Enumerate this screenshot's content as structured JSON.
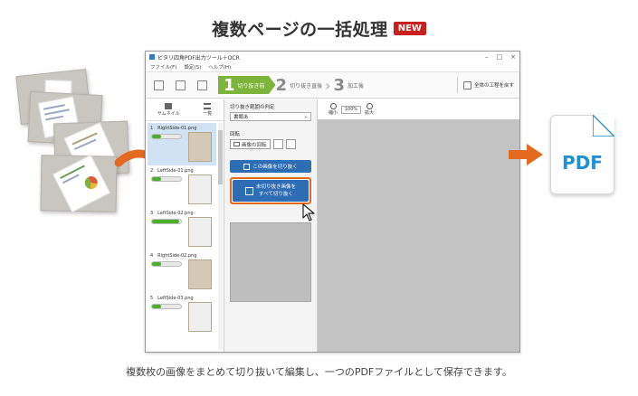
{
  "heading": {
    "title": "複数ページの一括処理",
    "badge": "NEW"
  },
  "window": {
    "title": "ピタリ四角PDF出力ツール＋OCR",
    "menu": [
      "ファイル(F)",
      "設定(S)",
      "ヘルプ(H)"
    ],
    "steps": [
      {
        "num": "1",
        "label": "切り抜き前"
      },
      {
        "num": "2",
        "label": "切り抜き直後"
      },
      {
        "num": "3",
        "label": "加工後"
      }
    ],
    "redo_label": "全体の工程を戻す",
    "view_tabs": [
      "サムネイル",
      "一覧"
    ],
    "thumbnails": [
      {
        "name": "1　RightSide-01.png",
        "progress": 0.3
      },
      {
        "name": "2　LeftSide-01.png",
        "progress": 0.3
      },
      {
        "name": "3　LeftSide-02.png",
        "progress": 0.95
      },
      {
        "name": "4　RightSide-02.png",
        "progress": 0.3
      },
      {
        "name": "5　LeftSide-03.png",
        "progress": 0.3
      }
    ],
    "crop_range_label": "切り抜き範囲の判定",
    "crop_select": "書類あ",
    "rotate_label": "回転",
    "rotate_button": "画像の回転",
    "crop_this": "この画像を切り抜く",
    "crop_all_line1": "未切り抜き画像を",
    "crop_all_line2": "すべて切り抜く",
    "zoom_out": "縮小",
    "zoom_value": "100%",
    "zoom_in": "拡大"
  },
  "pdf_label": "PDF",
  "caption": "複数枚の画像をまとめて切り抜いて編集し、一つのPDFファイルとして保存できます。",
  "colors": {
    "accent_orange": "#e46a1f",
    "step_green": "#7db43a",
    "button_blue": "#2e6db4",
    "pdf_blue": "#1f8fd6",
    "badge_red": "#c8201e"
  }
}
